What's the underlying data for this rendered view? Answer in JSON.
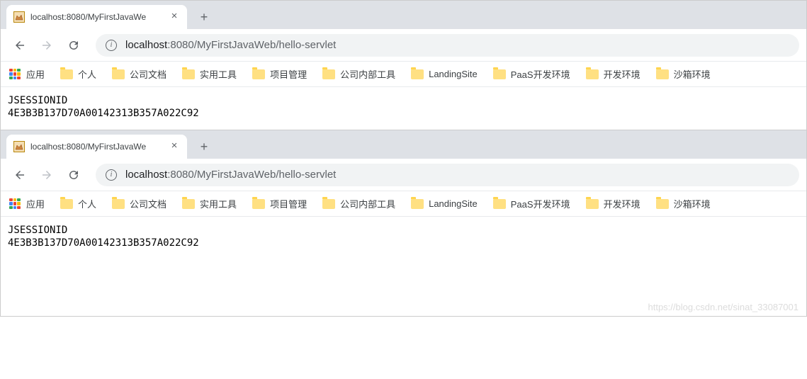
{
  "windows": [
    {
      "tab_title": "localhost:8080/MyFirstJavaWe",
      "url_host": "localhost",
      "url_port_path": ":8080/MyFirstJavaWeb/hello-servlet",
      "content_line1": "JSESSIONID",
      "content_line2": "4E3B3B137D70A00142313B357A022C92"
    },
    {
      "tab_title": "localhost:8080/MyFirstJavaWe",
      "url_host": "localhost",
      "url_port_path": ":8080/MyFirstJavaWeb/hello-servlet",
      "content_line1": "JSESSIONID",
      "content_line2": "4E3B3B137D70A00142313B357A022C92"
    }
  ],
  "apps_label": "应用",
  "bookmarks": [
    {
      "label": "个人"
    },
    {
      "label": "公司文档"
    },
    {
      "label": "实用工具"
    },
    {
      "label": "项目管理"
    },
    {
      "label": "公司内部工具"
    },
    {
      "label": "LandingSite"
    },
    {
      "label": "PaaS开发环境"
    },
    {
      "label": "开发环境"
    },
    {
      "label": "沙箱环境"
    }
  ],
  "watermark": "https://blog.csdn.net/sinat_33087001"
}
